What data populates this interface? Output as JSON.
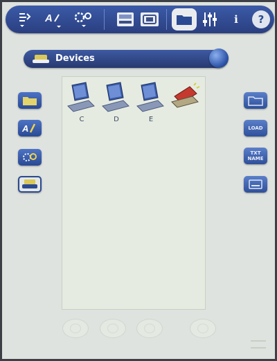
{
  "toolbar": {
    "info_label": "i",
    "help_label": "?"
  },
  "devices_bar": {
    "title": "Devices"
  },
  "drives": [
    {
      "letter": "C",
      "icon": "laptop-drive-icon"
    },
    {
      "letter": "D",
      "icon": "laptop-drive-icon"
    },
    {
      "letter": "E",
      "icon": "laptop-drive-icon"
    },
    {
      "letter": "",
      "icon": "eraser-drive-icon"
    }
  ],
  "left_buttons": [
    "folder-icon",
    "font-icon",
    "settings-icon",
    "devices-icon"
  ],
  "right_buttons": [
    {
      "icon": "folder-open-icon",
      "label": ""
    },
    {
      "icon": "load-icon",
      "label": "LOAD"
    },
    {
      "icon": "rename-icon",
      "label": "TXT NAME"
    },
    {
      "icon": "drive-icon",
      "label": ""
    }
  ],
  "colors": {
    "toolbar": "#2f4a92",
    "screen_bg": "#dfe3df",
    "accent_red": "#c43a2e"
  }
}
